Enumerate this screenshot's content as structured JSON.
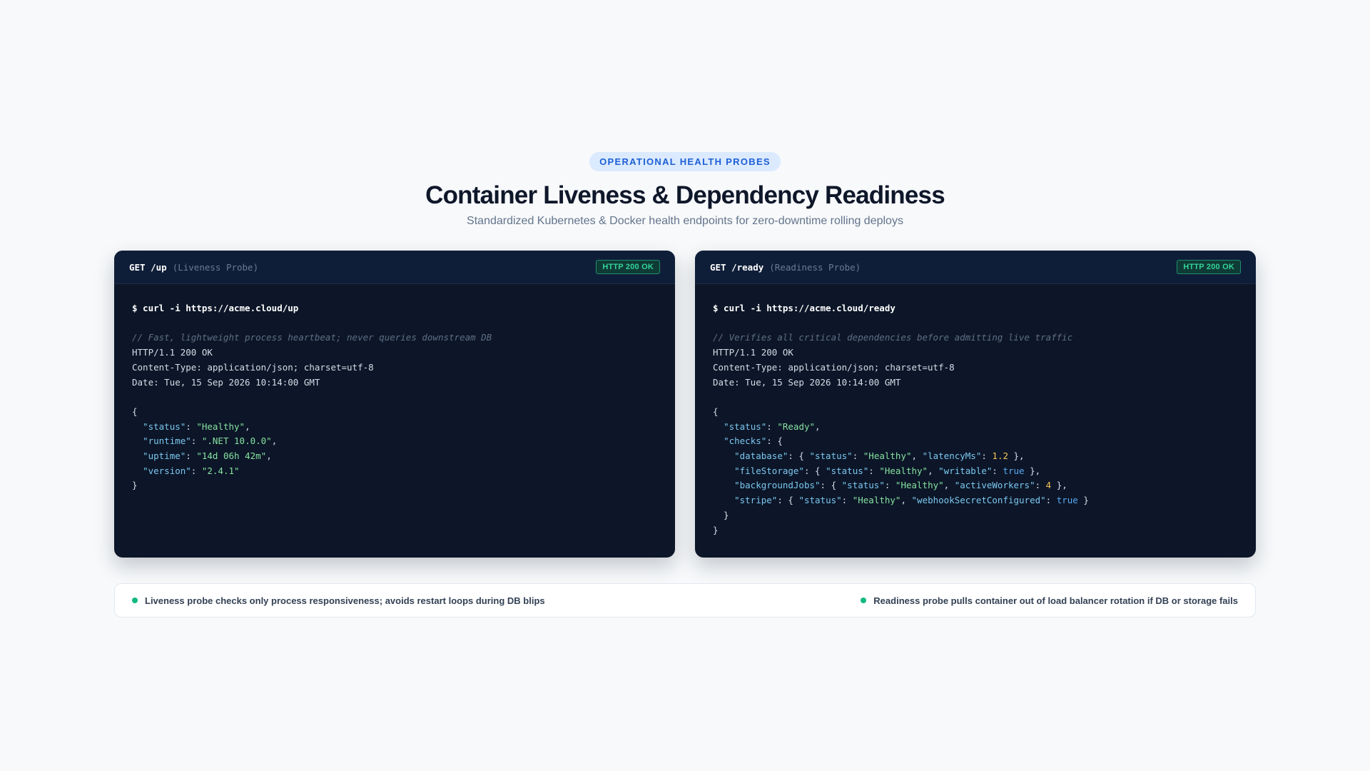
{
  "header": {
    "eyebrow": "OPERATIONAL HEALTH PROBES",
    "title": "Container Liveness & Dependency Readiness",
    "subtitle": "Standardized Kubernetes & Docker health endpoints for zero-downtime rolling deploys"
  },
  "liveness": {
    "endpoint": "GET /up",
    "probe": "(Liveness Probe)",
    "badge": "HTTP 200 OK",
    "command": "$ curl -i https://acme.cloud/up",
    "comment": "// Fast, lightweight process heartbeat; never queries downstream DB",
    "status_line": "HTTP/1.1 200 OK",
    "content_type": "Content-Type: application/json; charset=utf-8",
    "date": "Date: Tue, 15 Sep 2026 10:14:00 GMT",
    "json": {
      "status_key": "\"status\"",
      "status_val": "\"Healthy\"",
      "runtime_key": "\"runtime\"",
      "runtime_val": "\".NET 10.0.0\"",
      "uptime_key": "\"uptime\"",
      "uptime_val": "\"14d 06h 42m\"",
      "version_key": "\"version\"",
      "version_val": "\"2.4.1\""
    }
  },
  "readiness": {
    "endpoint": "GET /ready",
    "probe": "(Readiness Probe)",
    "badge": "HTTP 200 OK",
    "command": "$ curl -i https://acme.cloud/ready",
    "comment": "// Verifies all critical dependencies before admitting live traffic",
    "status_line": "HTTP/1.1 200 OK",
    "content_type": "Content-Type: application/json; charset=utf-8",
    "date": "Date: Tue, 15 Sep 2026 10:14:00 GMT",
    "json": {
      "status_key": "\"status\"",
      "status_val": "\"Ready\"",
      "checks_key": "\"checks\"",
      "database_key": "\"database\"",
      "database_status": "\"Healthy\"",
      "latency_key": "\"latencyMs\"",
      "latency_val": "1.2",
      "filestorage_key": "\"fileStorage\"",
      "filestorage_status": "\"Healthy\"",
      "writable_key": "\"writable\"",
      "writable_val": "true",
      "jobs_key": "\"backgroundJobs\"",
      "jobs_status": "\"Healthy\"",
      "workers_key": "\"activeWorkers\"",
      "workers_val": "4",
      "stripe_key": "\"stripe\"",
      "stripe_status": "\"Healthy\"",
      "webhook_key": "\"webhookSecretConfigured\"",
      "webhook_val": "true",
      "inner_status_key": "\"status\""
    }
  },
  "notes": {
    "left": "Liveness probe checks only process responsiveness; avoids restart loops during DB blips",
    "right": "Readiness probe pulls container out of load balancer rotation if DB or storage fails"
  },
  "colors": {
    "panel_bg": "#0c1628",
    "accent": "#1d5fd6",
    "ok_green": "#34d399"
  }
}
